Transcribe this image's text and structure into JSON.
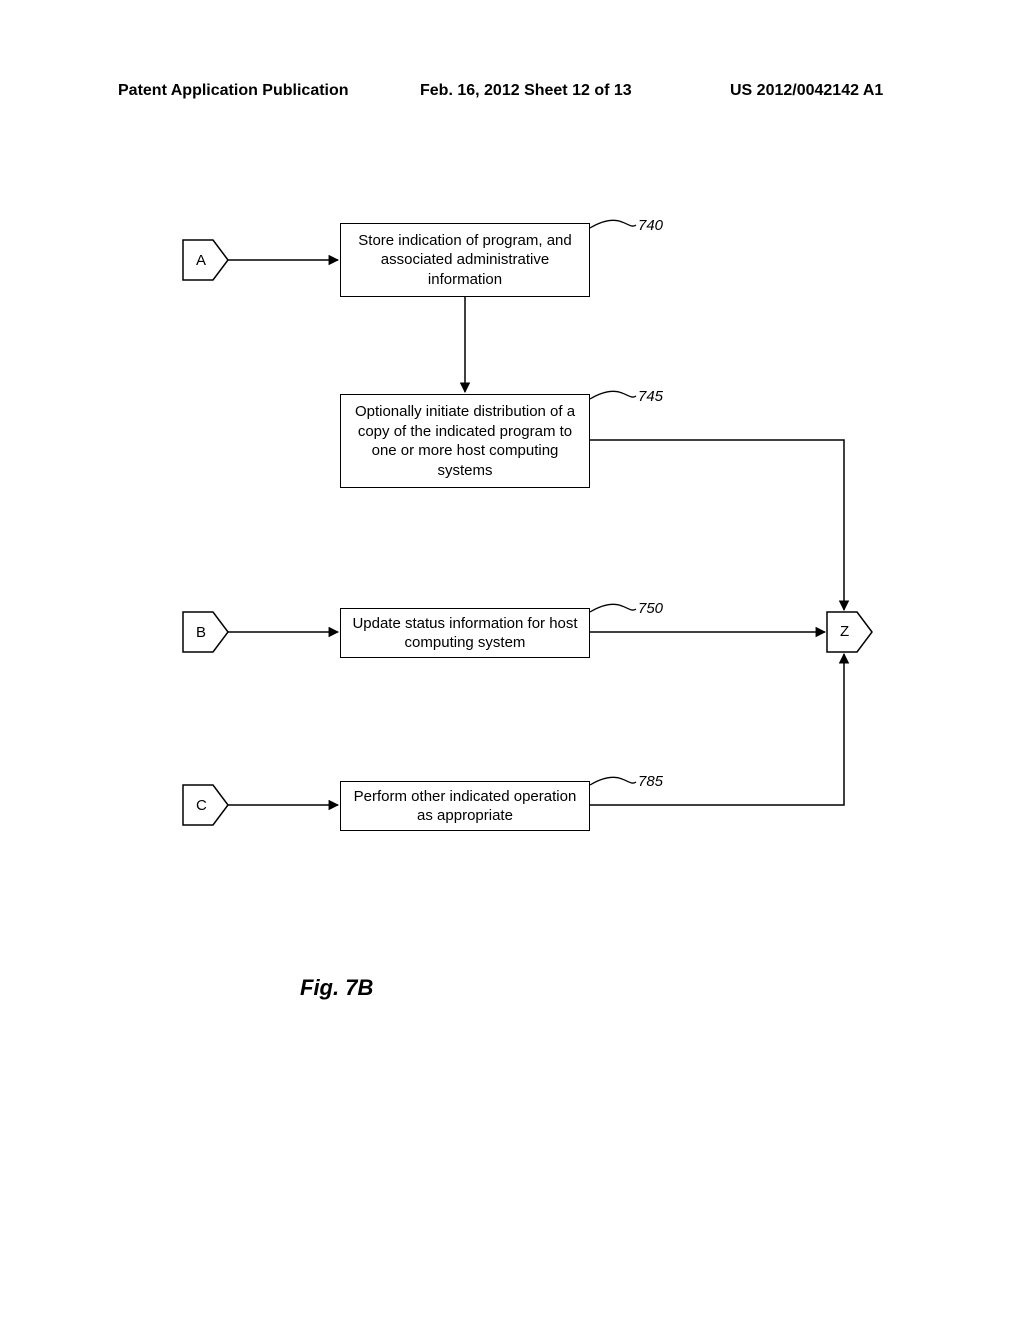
{
  "header": {
    "left": "Patent Application Publication",
    "center": "Feb. 16, 2012  Sheet 12 of 13",
    "right": "US 2012/0042142 A1"
  },
  "connectors": {
    "A": "A",
    "B": "B",
    "C": "C",
    "Z": "Z"
  },
  "boxes": {
    "b740": "Store indication of program, and associated administrative information",
    "b745": "Optionally initiate distribution of a copy of the indicated program to one or more host computing systems",
    "b750": "Update status information for host computing system",
    "b785": "Perform other indicated operation as appropriate"
  },
  "refs": {
    "r740": "740",
    "r745": "745",
    "r750": "750",
    "r785": "785"
  },
  "figure_label": "Fig. 7B"
}
